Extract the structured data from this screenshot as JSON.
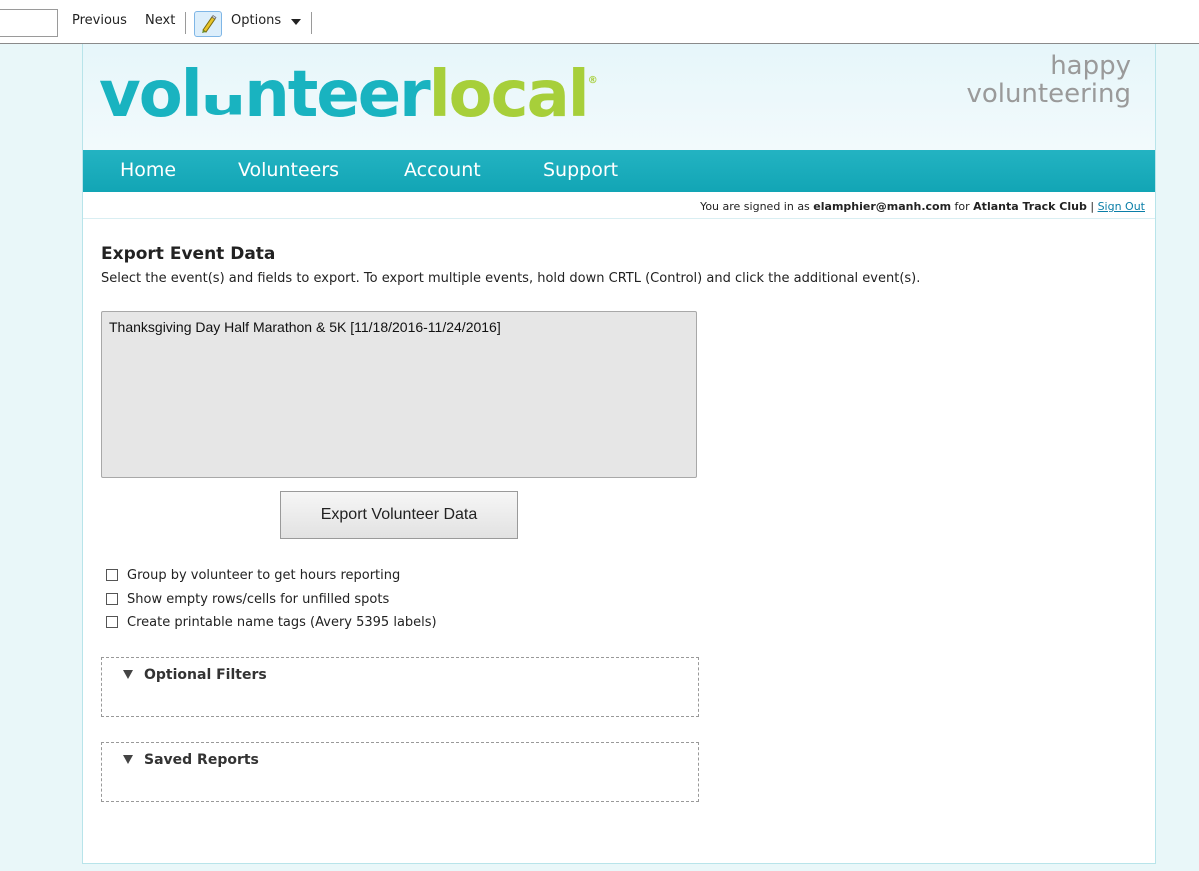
{
  "findbar": {
    "previous_label": "Previous",
    "next_label": "Next",
    "options_label": "Options"
  },
  "brand": {
    "logo_part1": "vol",
    "logo_smile": "u",
    "logo_part2": "nteer",
    "logo_part3": "local",
    "logo_reg": "®",
    "tagline_line1": "happy",
    "tagline_line2": "volunteering",
    "primary_color": "#19b3c0",
    "secondary_color": "#a7cf3a"
  },
  "nav": {
    "items": [
      "Home",
      "Volunteers",
      "Account",
      "Support"
    ]
  },
  "session": {
    "prefix": "You are signed in as",
    "user": "elamphier@manh.com",
    "middle": "for",
    "org": "Atlanta Track Club",
    "separator": "|",
    "signout": "Sign Out"
  },
  "main": {
    "title": "Export Event Data",
    "subtitle": "Select the event(s) and fields to export. To export multiple events, hold down CRTL (Control) and click the additional event(s).",
    "events": [
      "Thanksgiving Day Half Marathon & 5K [11/18/2016-11/24/2016]"
    ],
    "export_button": "Export Volunteer Data",
    "options": [
      {
        "label": "Group by volunteer to get hours reporting",
        "checked": false
      },
      {
        "label": "Show empty rows/cells for unfilled spots",
        "checked": false
      },
      {
        "label": "Create printable name tags (Avery 5395 labels)",
        "checked": false
      }
    ],
    "filters_title": "Optional Filters",
    "saved_title": "Saved Reports"
  }
}
